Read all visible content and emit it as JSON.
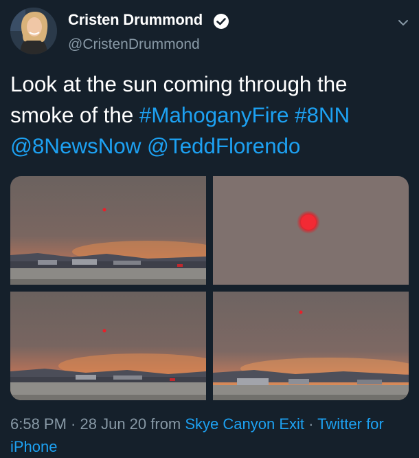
{
  "author": {
    "name": "Cristen Drummond",
    "handle": "@CristenDrummond"
  },
  "tweet": {
    "text_plain_1": "Look at the sun coming through the smoke of the ",
    "hashtag_1": "#MahoganyFire",
    "space_1": " ",
    "hashtag_2": "#8NN",
    "mention_1": "@8NewsNow",
    "space_2": " ",
    "mention_2": "@TeddFlorendo"
  },
  "meta": {
    "time": "6:58 PM",
    "sep1": " · ",
    "date": "28 Jun 20",
    "from": " from ",
    "source": "Skye Canyon Exit",
    "sep2": " · ",
    "client": "Twitter for iPhone"
  },
  "icons": {
    "verified": "verified-badge-icon",
    "caret": "chevron-down-icon"
  },
  "colors": {
    "background": "#15202b",
    "text": "#ffffff",
    "secondary": "#8899a6",
    "link": "#1da1f2",
    "sun": "#e8202a"
  }
}
